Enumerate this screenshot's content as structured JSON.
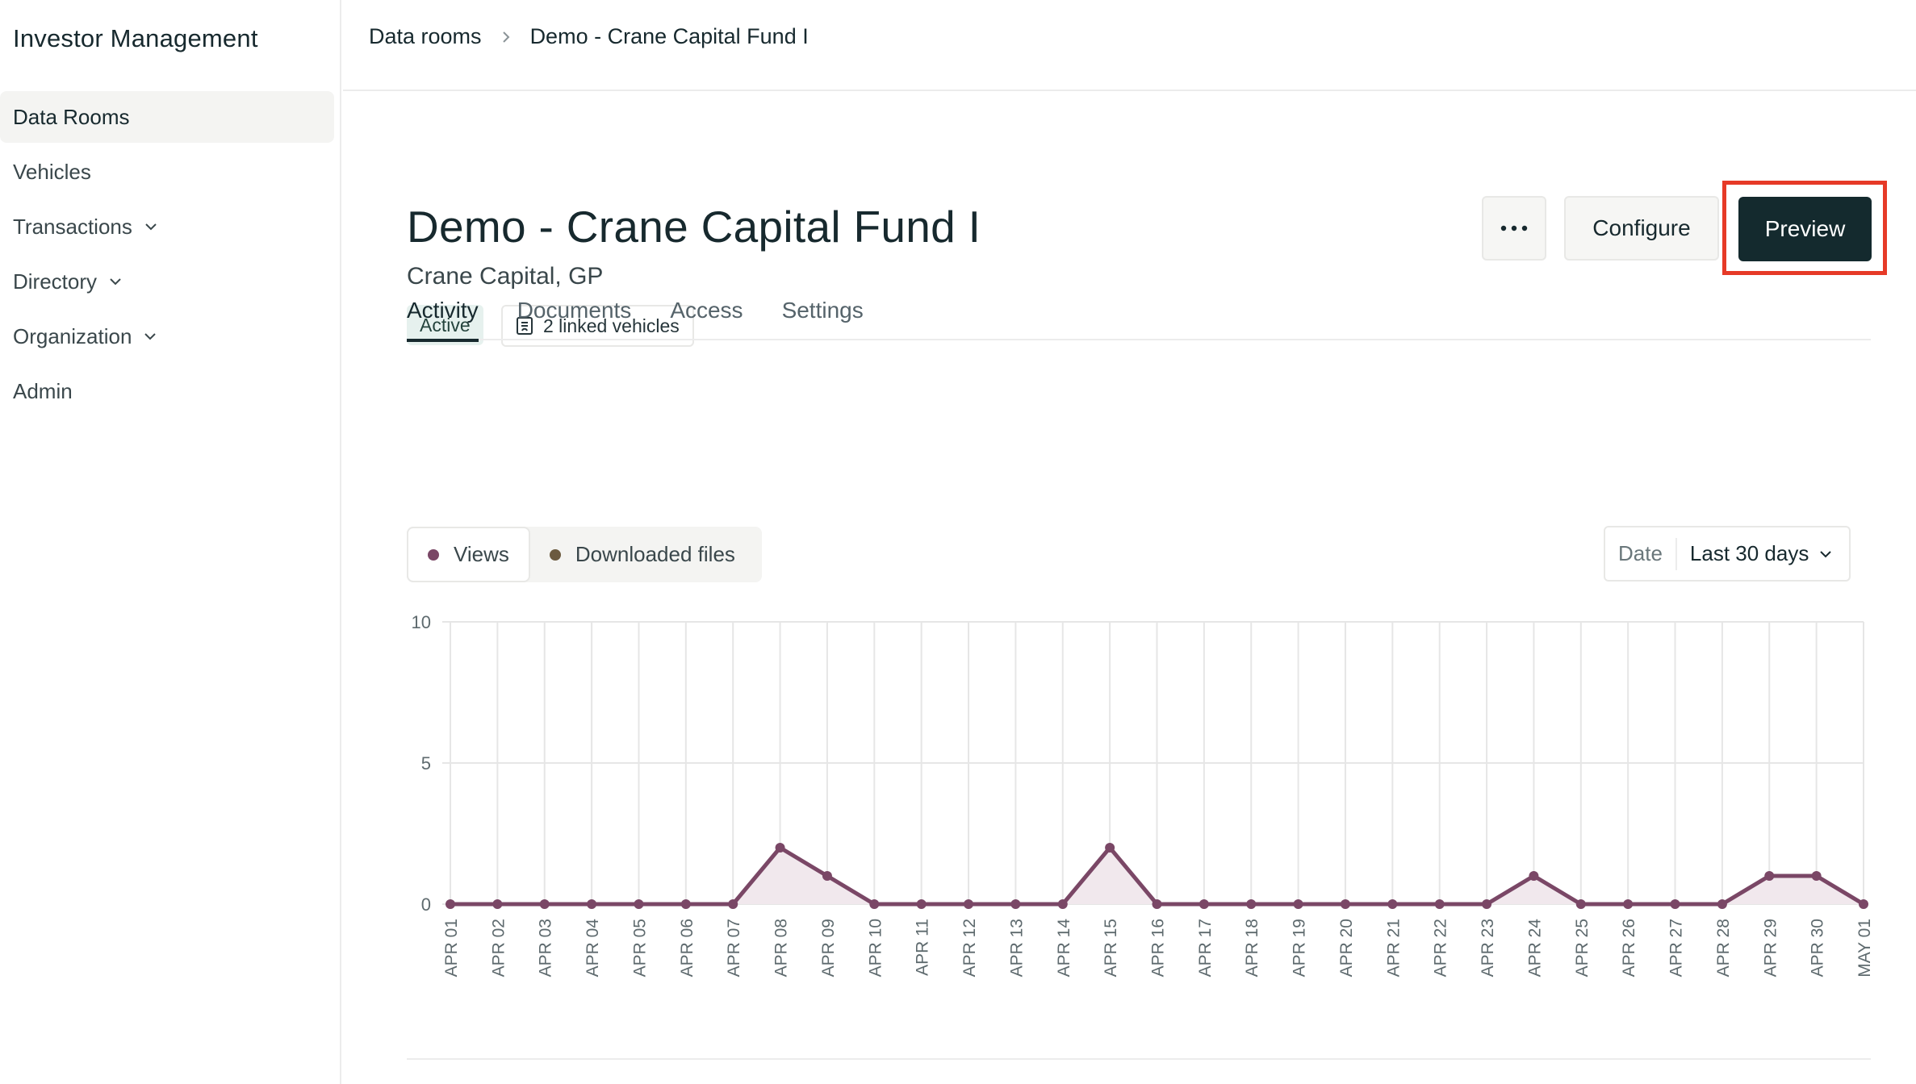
{
  "app": {
    "title": "Investor Management"
  },
  "sidebar": {
    "items": [
      {
        "label": "Data Rooms",
        "active": true,
        "expandable": false
      },
      {
        "label": "Vehicles",
        "active": false,
        "expandable": false
      },
      {
        "label": "Transactions",
        "active": false,
        "expandable": true
      },
      {
        "label": "Directory",
        "active": false,
        "expandable": true
      },
      {
        "label": "Organization",
        "active": false,
        "expandable": true
      },
      {
        "label": "Admin",
        "active": false,
        "expandable": false
      }
    ]
  },
  "breadcrumb": {
    "parent": "Data rooms",
    "current": "Demo - Crane Capital Fund I"
  },
  "header": {
    "title": "Demo - Crane Capital Fund I",
    "subtitle": "Crane Capital, GP",
    "status": "Active",
    "linked": "2 linked vehicles",
    "more_icon": "more-horizontal-icon",
    "configure_label": "Configure",
    "preview_label": "Preview"
  },
  "tabs": [
    {
      "label": "Activity",
      "active": true
    },
    {
      "label": "Documents",
      "active": false
    },
    {
      "label": "Access",
      "active": false
    },
    {
      "label": "Settings",
      "active": false
    }
  ],
  "legend": {
    "views_label": "Views",
    "downloads_label": "Downloaded files"
  },
  "date_filter": {
    "label": "Date",
    "value": "Last 30 days"
  },
  "colors": {
    "views": "#7a4766",
    "downloads": "#6b5a3f",
    "views_fill": "#f1e8ed",
    "accent_dark": "#142a2e",
    "highlight": "#e63a27"
  },
  "chart_data": {
    "type": "line",
    "x": [
      "APR 01",
      "APR 02",
      "APR 03",
      "APR 04",
      "APR 05",
      "APR 06",
      "APR 07",
      "APR 08",
      "APR 09",
      "APR 10",
      "APR 11",
      "APR 12",
      "APR 13",
      "APR 14",
      "APR 15",
      "APR 16",
      "APR 17",
      "APR 18",
      "APR 19",
      "APR 20",
      "APR 21",
      "APR 22",
      "APR 23",
      "APR 24",
      "APR 25",
      "APR 26",
      "APR 27",
      "APR 28",
      "APR 29",
      "APR 30",
      "MAY 01"
    ],
    "series": [
      {
        "name": "Views",
        "values": [
          0,
          0,
          0,
          0,
          0,
          0,
          0,
          2,
          1,
          0,
          0,
          0,
          0,
          0,
          2,
          0,
          0,
          0,
          0,
          0,
          0,
          0,
          0,
          1,
          0,
          0,
          0,
          0,
          1,
          1,
          0
        ]
      }
    ],
    "yticks": [
      "0",
      "5",
      "10"
    ],
    "ylim": [
      0,
      10
    ],
    "grid": true
  }
}
